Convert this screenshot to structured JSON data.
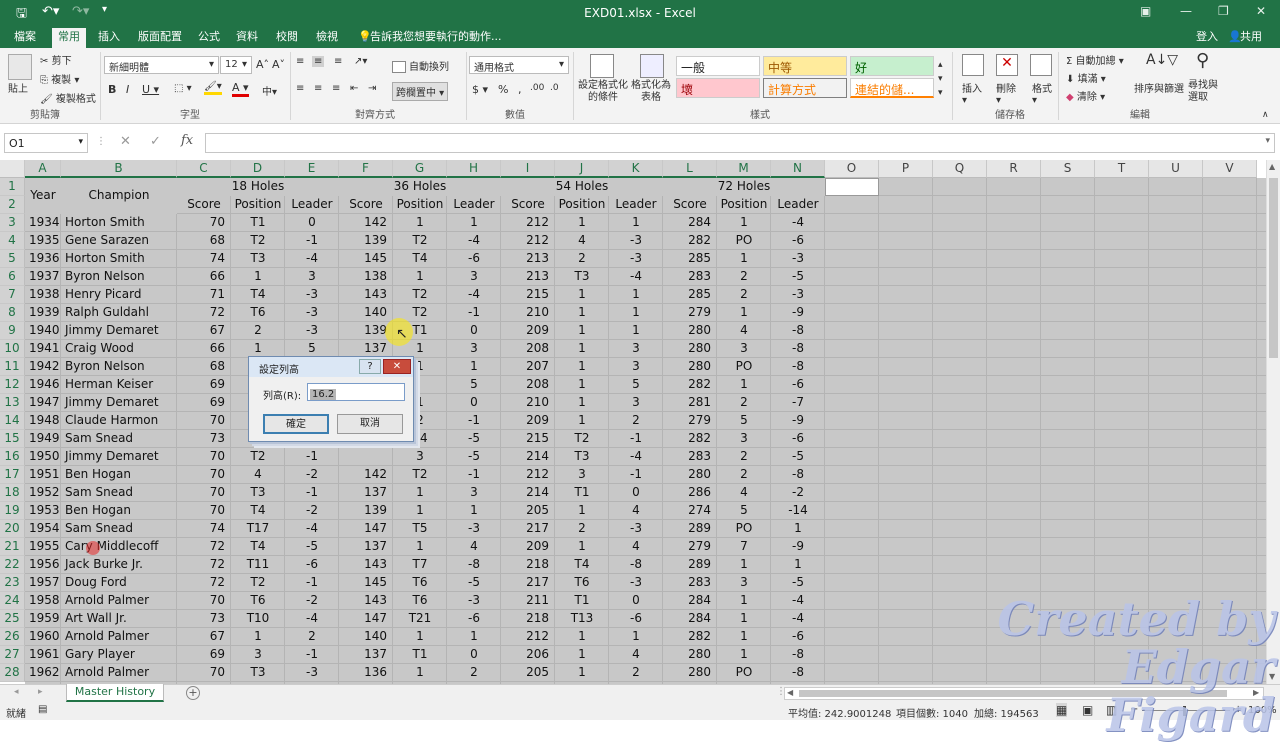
{
  "title": "EXD01.xlsx - Excel",
  "tabs": [
    "檔案",
    "常用",
    "插入",
    "版面配置",
    "公式",
    "資料",
    "校閱",
    "檢視"
  ],
  "tell_me": "告訴我您想要執行的動作...",
  "sign_in": "登入",
  "share": "共用",
  "ribbon": {
    "paste": "貼上",
    "cut": "剪下",
    "copy": "複製",
    "format_painter": "複製格式",
    "clipboard": "剪貼簿",
    "font_name": "新細明體",
    "font_size": "12",
    "font_group": "字型",
    "wrap": "自動換列",
    "merge": "跨欄置中",
    "align_group": "對齊方式",
    "num_format": "通用格式",
    "number_group": "數值",
    "cond_format": "設定格式化的條件",
    "format_table": "格式化為表格",
    "styles": [
      "一般",
      "中等",
      "好",
      "壞",
      "計算方式",
      "連結的儲..."
    ],
    "style_group": "樣式",
    "insert": "插入",
    "delete": "刪除",
    "format": "格式",
    "cells_group": "儲存格",
    "autosum": "自動加總",
    "fill": "填滿",
    "clear": "清除",
    "sort": "排序與篩選",
    "find": "尋找與選取",
    "edit_group": "編輯"
  },
  "namebox": "O1",
  "cols": [
    "A",
    "B",
    "C",
    "D",
    "E",
    "F",
    "G",
    "H",
    "I",
    "J",
    "K",
    "L",
    "M",
    "N",
    "O",
    "P",
    "Q",
    "R",
    "S",
    "T",
    "U",
    "V"
  ],
  "header1": {
    "year": "Year",
    "champ": "Champion",
    "h18": "18 Holes",
    "h36": "36 Holes",
    "h54": "54 Holes",
    "h72": "72 Holes"
  },
  "sub": [
    "Score",
    "Position",
    "Leader",
    "Score",
    "Position",
    "Leader",
    "Score",
    "Position",
    "Leader",
    "Score",
    "Position",
    "Leader"
  ],
  "rows": [
    [
      "1934",
      "Horton Smith",
      "70",
      "T1",
      "0",
      "142",
      "1",
      "1",
      "212",
      "1",
      "1",
      "284",
      "1",
      "-4"
    ],
    [
      "1935",
      "Gene Sarazen",
      "68",
      "T2",
      "-1",
      "139",
      "T2",
      "-4",
      "212",
      "4",
      "-3",
      "282",
      "PO",
      "-6"
    ],
    [
      "1936",
      "Horton Smith",
      "74",
      "T3",
      "-4",
      "145",
      "T4",
      "-6",
      "213",
      "2",
      "-3",
      "285",
      "1",
      "-3"
    ],
    [
      "1937",
      "Byron Nelson",
      "66",
      "1",
      "3",
      "138",
      "1",
      "3",
      "213",
      "T3",
      "-4",
      "283",
      "2",
      "-5"
    ],
    [
      "1938",
      "Henry Picard",
      "71",
      "T4",
      "-3",
      "143",
      "T2",
      "-4",
      "215",
      "1",
      "1",
      "285",
      "2",
      "-3"
    ],
    [
      "1939",
      "Ralph Guldahl",
      "72",
      "T6",
      "-3",
      "140",
      "T2",
      "-1",
      "210",
      "1",
      "1",
      "279",
      "1",
      "-9"
    ],
    [
      "1940",
      "Jimmy Demaret",
      "67",
      "2",
      "-3",
      "139",
      "T1",
      "0",
      "209",
      "1",
      "1",
      "280",
      "4",
      "-8"
    ],
    [
      "1941",
      "Craig Wood",
      "66",
      "1",
      "5",
      "137",
      "1",
      "3",
      "208",
      "1",
      "3",
      "280",
      "3",
      "-8"
    ],
    [
      "1942",
      "Byron Nelson",
      "68",
      "",
      "",
      "",
      "1",
      "1",
      "207",
      "1",
      "3",
      "280",
      "PO",
      "-8"
    ],
    [
      "1946",
      "Herman Keiser",
      "69",
      "",
      "",
      "",
      "",
      "5",
      "208",
      "1",
      "5",
      "282",
      "1",
      "-6"
    ],
    [
      "1947",
      "Jimmy Demaret",
      "69",
      "",
      "",
      "",
      "1",
      "0",
      "210",
      "1",
      "3",
      "281",
      "2",
      "-7"
    ],
    [
      "1948",
      "Claude Harmon",
      "70",
      "",
      "",
      "",
      "2",
      "-1",
      "209",
      "1",
      "2",
      "279",
      "5",
      "-9"
    ],
    [
      "1949",
      "Sam Snead",
      "73",
      "",
      "",
      "",
      "14",
      "-5",
      "215",
      "T2",
      "-1",
      "282",
      "3",
      "-6"
    ],
    [
      "1950",
      "Jimmy Demaret",
      "70",
      "T2",
      "-1",
      "",
      "3",
      "-5",
      "214",
      "T3",
      "-4",
      "283",
      "2",
      "-5"
    ],
    [
      "1951",
      "Ben Hogan",
      "70",
      "4",
      "-2",
      "142",
      "T2",
      "-1",
      "212",
      "3",
      "-1",
      "280",
      "2",
      "-8"
    ],
    [
      "1952",
      "Sam Snead",
      "70",
      "T3",
      "-1",
      "137",
      "1",
      "3",
      "214",
      "T1",
      "0",
      "286",
      "4",
      "-2"
    ],
    [
      "1953",
      "Ben Hogan",
      "70",
      "T4",
      "-2",
      "139",
      "1",
      "1",
      "205",
      "1",
      "4",
      "274",
      "5",
      "-14"
    ],
    [
      "1954",
      "Sam Snead",
      "74",
      "T17",
      "-4",
      "147",
      "T5",
      "-3",
      "217",
      "2",
      "-3",
      "289",
      "PO",
      "1"
    ],
    [
      "1955",
      "Cary Middlecoff",
      "72",
      "T4",
      "-5",
      "137",
      "1",
      "4",
      "209",
      "1",
      "4",
      "279",
      "7",
      "-9"
    ],
    [
      "1956",
      "Jack Burke Jr.",
      "72",
      "T11",
      "-6",
      "143",
      "T7",
      "-8",
      "218",
      "T4",
      "-8",
      "289",
      "1",
      "1"
    ],
    [
      "1957",
      "Doug Ford",
      "72",
      "T2",
      "-1",
      "145",
      "T6",
      "-5",
      "217",
      "T6",
      "-3",
      "283",
      "3",
      "-5"
    ],
    [
      "1958",
      "Arnold Palmer",
      "70",
      "T6",
      "-2",
      "143",
      "T6",
      "-3",
      "211",
      "T1",
      "0",
      "284",
      "1",
      "-4"
    ],
    [
      "1959",
      "Art Wall Jr.",
      "73",
      "T10",
      "-4",
      "147",
      "T21",
      "-6",
      "218",
      "T13",
      "-6",
      "284",
      "1",
      "-4"
    ],
    [
      "1960",
      "Arnold Palmer",
      "67",
      "1",
      "2",
      "140",
      "1",
      "1",
      "212",
      "1",
      "1",
      "282",
      "1",
      "-6"
    ],
    [
      "1961",
      "Gary Player",
      "69",
      "3",
      "-1",
      "137",
      "T1",
      "0",
      "206",
      "1",
      "4",
      "280",
      "1",
      "-8"
    ],
    [
      "1962",
      "Arnold Palmer",
      "70",
      "T3",
      "-3",
      "136",
      "1",
      "2",
      "205",
      "1",
      "2",
      "280",
      "PO",
      "-8"
    ]
  ],
  "dialog": {
    "title": "設定列高",
    "label": "列高(R):",
    "value": "16.2",
    "ok": "確定",
    "cancel": "取消",
    "help": "?",
    "close": "✕"
  },
  "sheet_tab": "Master History",
  "status": {
    "ready": "就緒",
    "avg": "平均值: 242.9001248",
    "count": "項目個數: 1040",
    "sum": "加總: 194563",
    "zoom": "100%"
  },
  "watermark": [
    "Created by",
    "Edgar Figard"
  ]
}
